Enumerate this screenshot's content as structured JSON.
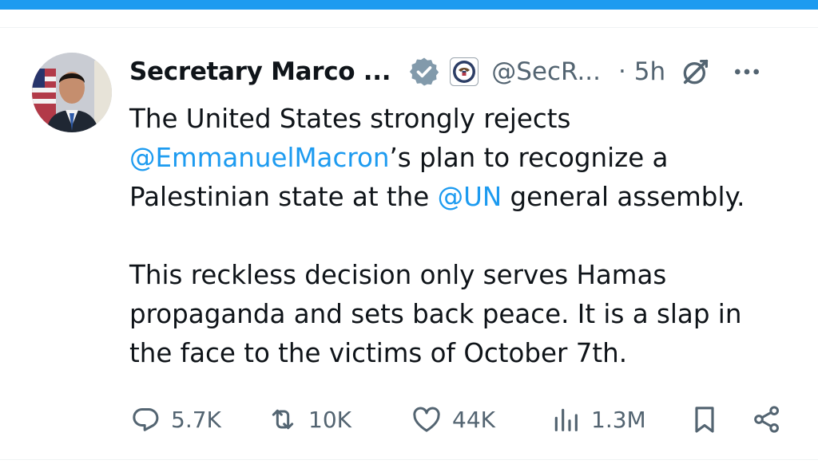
{
  "author": {
    "name": "Secretary Marco ...",
    "handle": "@SecR...",
    "time": "· 5h"
  },
  "tweet": {
    "line1": "The United States strongly rejects",
    "mention1": "@EmmanuelMacron",
    "line2_rest": "’s plan to recognize a",
    "line3_pre": "Palestinian state at the ",
    "mention2": "@UN",
    "line3_post": " general assembly.",
    "para2": "This reckless decision only serves Hamas propaganda and sets back peace. It is a slap in the face to the victims of October 7th."
  },
  "actions": {
    "replies": "5.7K",
    "reposts": "10K",
    "likes": "44K",
    "views": "1.3M"
  },
  "colors": {
    "accent": "#1d9bf0",
    "text": "#0f1419",
    "secondary": "#536471"
  },
  "icons": [
    "verified-badge-icon",
    "state-department-seal-icon",
    "grok-icon",
    "more-icon",
    "reply-icon",
    "repost-icon",
    "like-icon",
    "views-icon",
    "bookmark-icon",
    "share-icon"
  ]
}
